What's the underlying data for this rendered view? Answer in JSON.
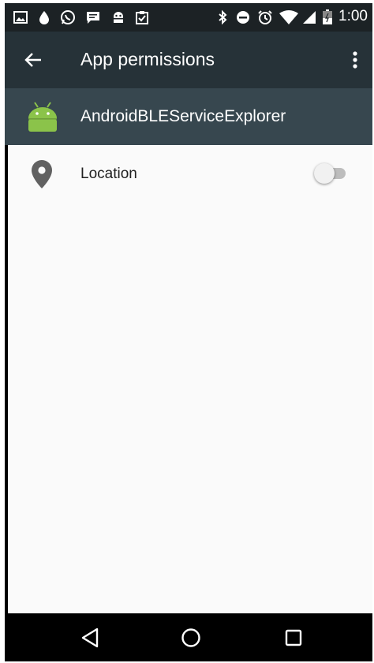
{
  "status_bar": {
    "time": "1:00",
    "left_icons": [
      "image-icon",
      "drop-icon",
      "whatsapp-icon",
      "message-icon",
      "android-debug-icon",
      "clipboard-check-icon"
    ],
    "right_icons": [
      "bluetooth-icon",
      "do-not-disturb-icon",
      "alarm-icon",
      "wifi-icon",
      "signal-icon",
      "battery-icon"
    ]
  },
  "toolbar": {
    "title": "App permissions",
    "back_icon": "arrow-back-icon",
    "overflow_icon": "more-vert-icon",
    "background": "#263238"
  },
  "app": {
    "name": "AndroidBLEServiceExplorer",
    "icon": "android-icon",
    "icon_color": "#8bc34a",
    "row_background": "#37474f"
  },
  "permissions": [
    {
      "label": "Location",
      "icon": "location-icon",
      "enabled": false
    }
  ],
  "nav_bar": {
    "buttons": [
      "back-triangle-icon",
      "home-circle-icon",
      "recents-square-icon"
    ]
  }
}
